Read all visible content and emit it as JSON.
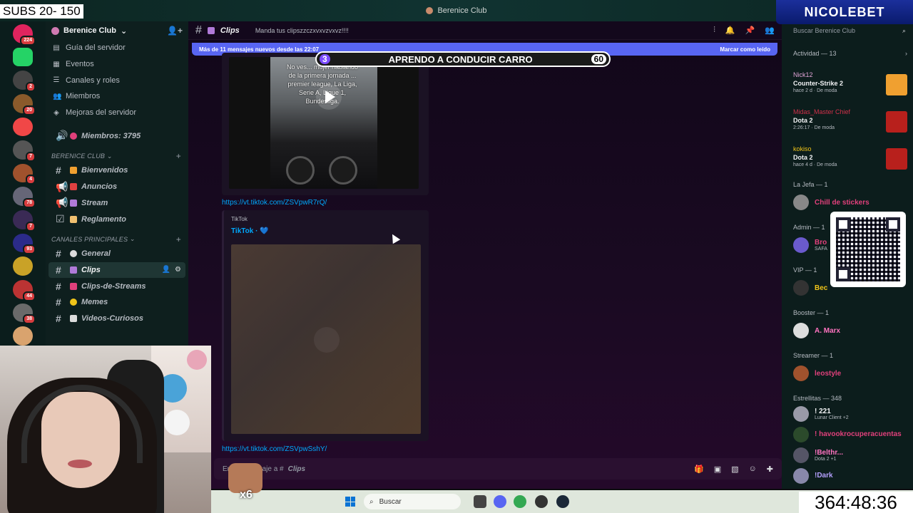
{
  "overlay": {
    "subs": "SUBS 20- 150",
    "brand": "NICOLEBET",
    "banner_left": "3",
    "banner_text": "APRENDO A CONDUCIR CARRO",
    "banner_right": "60",
    "timer": "364:48:36",
    "multiplier": "x6"
  },
  "window": {
    "title": "Berenice Club"
  },
  "servers": [
    {
      "badge": "224",
      "color": "#e0245e"
    },
    {
      "badge": "",
      "color": "#25d366"
    },
    {
      "badge": "2",
      "color": "#444"
    },
    {
      "badge": "20",
      "color": "#8a5a2b"
    },
    {
      "badge": "",
      "color": "#f04747"
    },
    {
      "badge": "7",
      "color": "#555"
    },
    {
      "badge": "4",
      "color": "#a0522d"
    },
    {
      "badge": "78",
      "color": "#667"
    },
    {
      "badge": "7",
      "color": "#3a2a55"
    },
    {
      "badge": "93",
      "color": "#2b2b8a"
    },
    {
      "badge": "",
      "color": "#c9a227"
    },
    {
      "badge": "44",
      "color": "#b33"
    },
    {
      "badge": "38",
      "color": "#6a6a6a"
    },
    {
      "badge": "",
      "color": "#d9a36e"
    }
  ],
  "sidebar": {
    "server_name": "Berenice Club",
    "menu": [
      "Guía del servidor",
      "Eventos",
      "Canales y roles",
      "Miembros",
      "Mejoras del servidor"
    ],
    "members_channel": "Miembros: 3795",
    "cat1": "BERENICE CLUB",
    "cat1_channels": [
      "Bienvenidos",
      "Anuncios",
      "Stream",
      "Reglamento"
    ],
    "cat2": "CANALES PRINCIPALES",
    "cat2_channels": [
      "General",
      "Clips",
      "Clips-de-Streams",
      "Memes",
      "Videos-Curiosos"
    ]
  },
  "header": {
    "channel": "Clips",
    "topic": "Manda tus clipszzczxvxvzvxvz!!!!"
  },
  "chat": {
    "new_messages": "Más de 11 mensajes nuevos desde las 22:07",
    "mark_read": "Marcar como leído",
    "video1_text": "No ves... mujer hablando de la primera jornada ... premier league, La Liga, Serie A, Ligue 1, Bundesliga.",
    "link1": "https://vt.tiktok.com/ZSVpwR7rQ/",
    "embed2_provider": "TikTok",
    "embed2_title": "TikTok · 💙",
    "link2": "https://vt.tiktok.com/ZSVpwSshY/",
    "composer_prefix": "Enviar mensaje a #",
    "composer_channel": "Clips"
  },
  "members": {
    "search": "Buscar Berenice Club",
    "activity_title": "Actividad — 13",
    "activities": [
      {
        "name": "Nick12",
        "game": "Counter-Strike 2",
        "time": "hace 2 d · De moda"
      },
      {
        "name": "Midas_Master Chief",
        "game": "Dota 2",
        "time": "2:26:17 · De moda"
      },
      {
        "name": "kokiso",
        "game": "Dota 2",
        "time": "hace 4 d · De moda"
      }
    ],
    "roles": [
      {
        "title": "La Jefa — 1",
        "name": "Chill de stickers",
        "sub": "",
        "color": "#e0407b"
      },
      {
        "title": "Admin — 1",
        "name": "Bro",
        "sub": "SAFA",
        "color": "#e0407b"
      },
      {
        "title": "VIP — 1",
        "name": "Bec",
        "sub": "",
        "color": "#f0c419"
      },
      {
        "title": "Booster — 1",
        "name": "A. Marx",
        "sub": "",
        "color": "#ff73c0"
      },
      {
        "title": "Streamer — 1",
        "name": "leostyle",
        "sub": "",
        "color": "#e0407b"
      }
    ],
    "estrellitas_title": "Estrellitas — 348",
    "estrellitas": [
      {
        "name": "! 221",
        "sub": "Lunar Client +2",
        "color": "#f2f3f5"
      },
      {
        "name": "! havookrocuperacuentas",
        "sub": "",
        "color": "#e0407b"
      },
      {
        "name": "!Belthr...",
        "sub": "Dota 2 +1",
        "color": "#ff73c0"
      },
      {
        "name": "!Dark",
        "sub": "",
        "color": "#b5a0ff"
      }
    ]
  },
  "taskbar": {
    "search": "Buscar"
  },
  "colors": {
    "accent": "#5865f2",
    "link": "#00a8fc"
  }
}
